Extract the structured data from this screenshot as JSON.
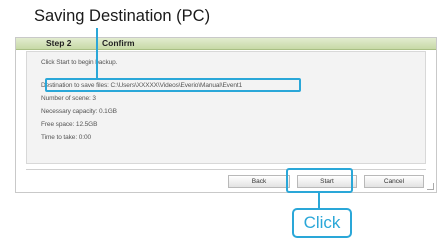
{
  "annotation": {
    "title": "Saving Destination (PC)",
    "click_label": "Click",
    "accent_color": "#2aa7d8"
  },
  "dialog": {
    "step_label": "Step 2",
    "step_title": "Confirm",
    "lines": [
      "Click Start to begin backup.",
      "Destination to save files: C:\\Users\\XXXXX\\Videos\\Everio\\Manual\\Event1",
      "Number of scene: 3",
      "Necessary capacity: 0.1GB",
      "Free space: 12.5GB",
      "Time to take: 0:00"
    ],
    "buttons": {
      "back": "Back",
      "start": "Start",
      "cancel": "Cancel"
    }
  }
}
